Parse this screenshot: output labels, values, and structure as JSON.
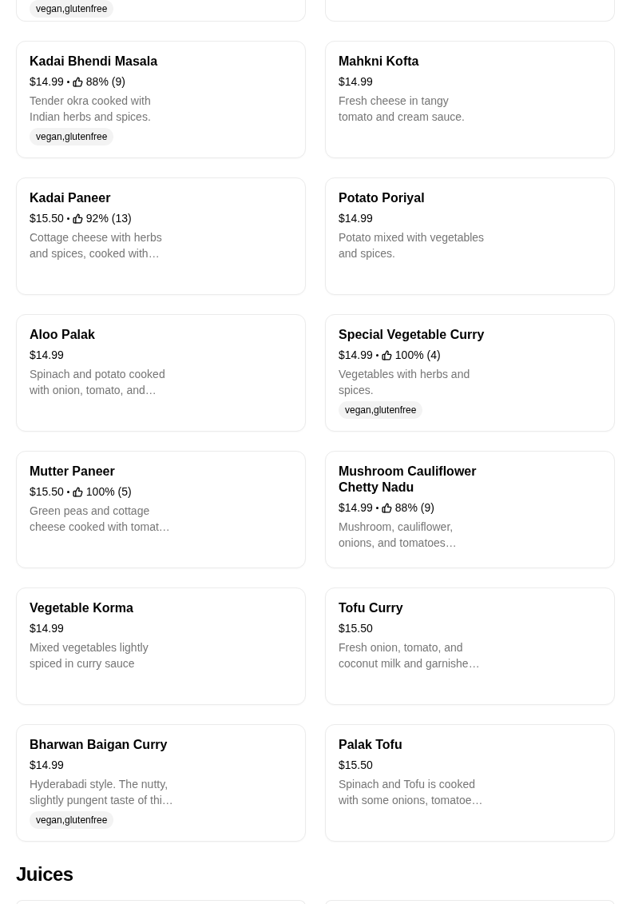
{
  "sections": [
    {
      "items": [
        {
          "kind": "tail",
          "tag": "vegan,glutenfree"
        },
        {
          "kind": "tail"
        },
        {
          "kind": "full",
          "name": "Kadai Bhendi Masala",
          "price": "$14.99",
          "rating": "88% (9)",
          "description": "Tender okra cooked with Indian herbs and spices.",
          "tag": "vegan,glutenfree"
        },
        {
          "kind": "full",
          "name": "Mahkni Kofta",
          "price": "$14.99",
          "description": "Fresh cheese in tangy tomato and cream sauce."
        },
        {
          "kind": "full",
          "name": "Kadai Paneer",
          "price": "$15.50",
          "rating": "92% (13)",
          "description": "Cottage cheese with herbs and spices, cooked with…"
        },
        {
          "kind": "full",
          "name": "Potato Poriyal",
          "price": "$14.99",
          "description": "Potato mixed with vegetables and spices."
        },
        {
          "kind": "full",
          "name": "Aloo Palak",
          "price": "$14.99",
          "description": "Spinach and potato cooked with onion, tomato, and…"
        },
        {
          "kind": "full",
          "name": "Special Vegetable Curry",
          "price": "$14.99",
          "rating": "100% (4)",
          "description": "Vegetables with herbs and spices.",
          "tag": "vegan,glutenfree"
        },
        {
          "kind": "full",
          "name": "Mutter Paneer",
          "price": "$15.50",
          "rating": "100% (5)",
          "description": "Green peas and cottage cheese cooked with tomat…"
        },
        {
          "kind": "full",
          "name": "Mushroom Cauliflower Chetty Nadu",
          "price": "$14.99",
          "rating": "88% (9)",
          "description": "Mushroom, cauliflower, onions, and tomatoes…"
        },
        {
          "kind": "full",
          "name": "Vegetable Korma",
          "price": "$14.99",
          "description": "Mixed vegetables lightly spiced in curry sauce"
        },
        {
          "kind": "full",
          "name": "Tofu Curry",
          "price": "$15.50",
          "description": "Fresh onion, tomato, and coconut milk and garnishe…"
        },
        {
          "kind": "full",
          "name": "Bharwan Baigan Curry",
          "price": "$14.99",
          "description": "Hyderabadi style. The nutty, slightly pungent taste of thi…",
          "tag": "vegan,glutenfree"
        },
        {
          "kind": "full",
          "name": "Palak Tofu",
          "price": "$15.50",
          "description": "Spinach and Tofu is cooked with some onions, tomatoe…"
        }
      ]
    },
    {
      "title": "Juices",
      "items": [
        {
          "kind": "head"
        },
        {
          "kind": "head"
        }
      ]
    }
  ]
}
